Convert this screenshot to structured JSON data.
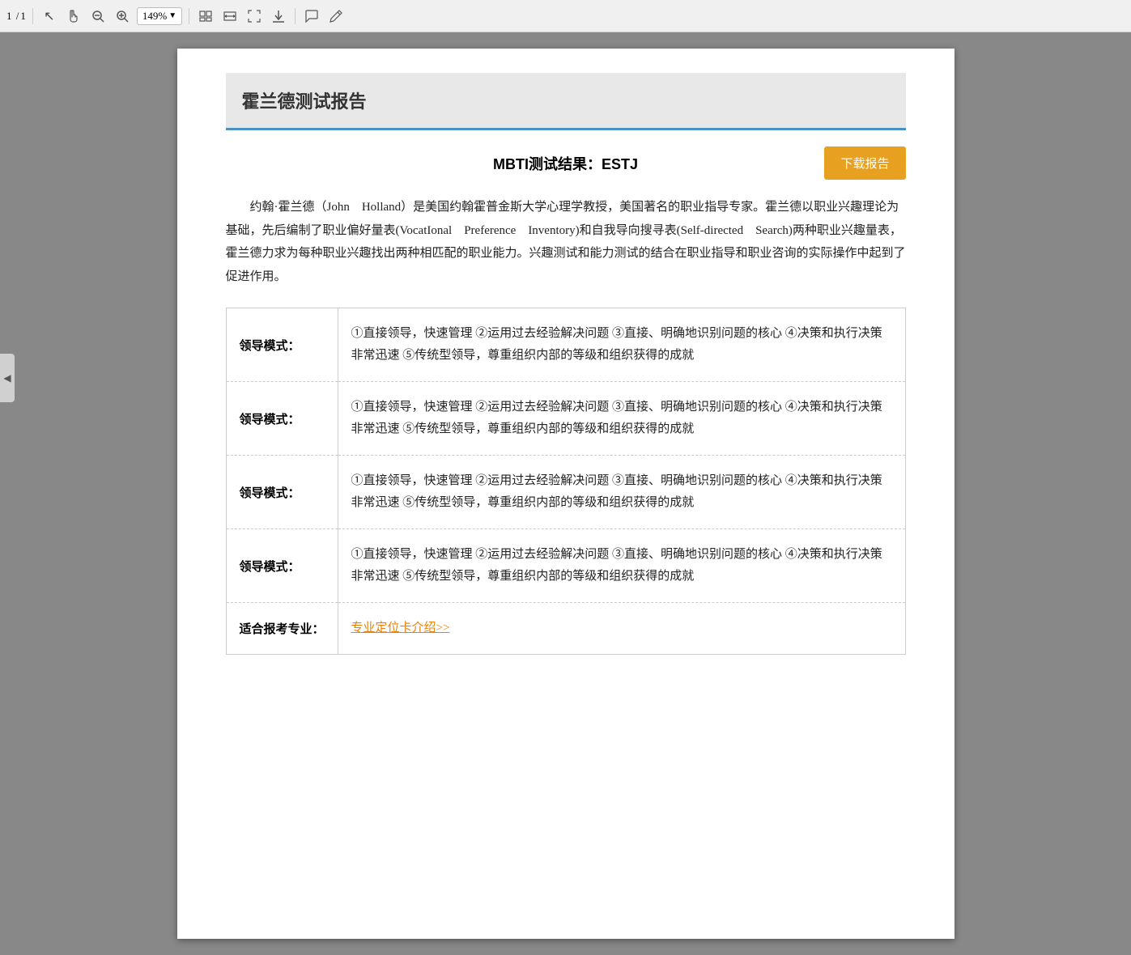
{
  "toolbar": {
    "page_current": "1",
    "page_total": "1",
    "zoom_level": "149%",
    "icons": [
      {
        "name": "cursor-tool",
        "symbol": "↖"
      },
      {
        "name": "hand-tool",
        "symbol": "✋"
      },
      {
        "name": "zoom-out",
        "symbol": "⊖"
      },
      {
        "name": "zoom-in",
        "symbol": "⊕"
      },
      {
        "name": "fit-page",
        "symbol": "⊞"
      },
      {
        "name": "fit-width",
        "symbol": "↔"
      },
      {
        "name": "fullscreen",
        "symbol": "⛶"
      },
      {
        "name": "download-tool",
        "symbol": "⬇"
      },
      {
        "name": "comment",
        "symbol": "💬"
      },
      {
        "name": "pen",
        "symbol": "✒"
      }
    ]
  },
  "sidebar": {
    "toggle_symbol": "◀"
  },
  "report": {
    "title": "霍兰德测试报告",
    "mbti_label": "MBTI测试结果：",
    "mbti_value": "ESTJ",
    "download_button": "下载报告",
    "description": "约翰·霍兰德（John　Holland）是美国约翰霍普金斯大学心理学教授，美国著名的职业指导专家。霍兰德以职业兴趣理论为基础，先后编制了职业偏好量表(VocatIonal　Preference　Inventory)和自我导向搜寻表(Self-directed　Search)两种职业兴趣量表，霍兰德力求为每种职业兴趣找出两种相匹配的职业能力。兴趣测试和能力测试的结合在职业指导和职业咨询的实际操作中起到了促进作用。",
    "table_rows": [
      {
        "label": "领导模式：",
        "content": "①直接领导，快速管理 ②运用过去经验解决问题 ③直接、明确地识别问题的核心 ④决策和执行决策非常迅速 ⑤传统型领导，尊重组织内部的等级和组织获得的成就"
      },
      {
        "label": "领导模式：",
        "content": "①直接领导，快速管理 ②运用过去经验解决问题 ③直接、明确地识别问题的核心 ④决策和执行决策非常迅速 ⑤传统型领导，尊重组织内部的等级和组织获得的成就"
      },
      {
        "label": "领导模式：",
        "content": "①直接领导，快速管理 ②运用过去经验解决问题 ③直接、明确地识别问题的核心 ④决策和执行决策非常迅速 ⑤传统型领导，尊重组织内部的等级和组织获得的成就"
      },
      {
        "label": "领导模式：",
        "content": "①直接领导，快速管理 ②运用过去经验解决问题 ③直接、明确地识别问题的核心 ④决策和执行决策非常迅速 ⑤传统型领导，尊重组织内部的等级和组织获得的成就"
      },
      {
        "label": "适合报考专业：",
        "content": "",
        "link_text": "专业定位卡介绍>>"
      }
    ]
  }
}
